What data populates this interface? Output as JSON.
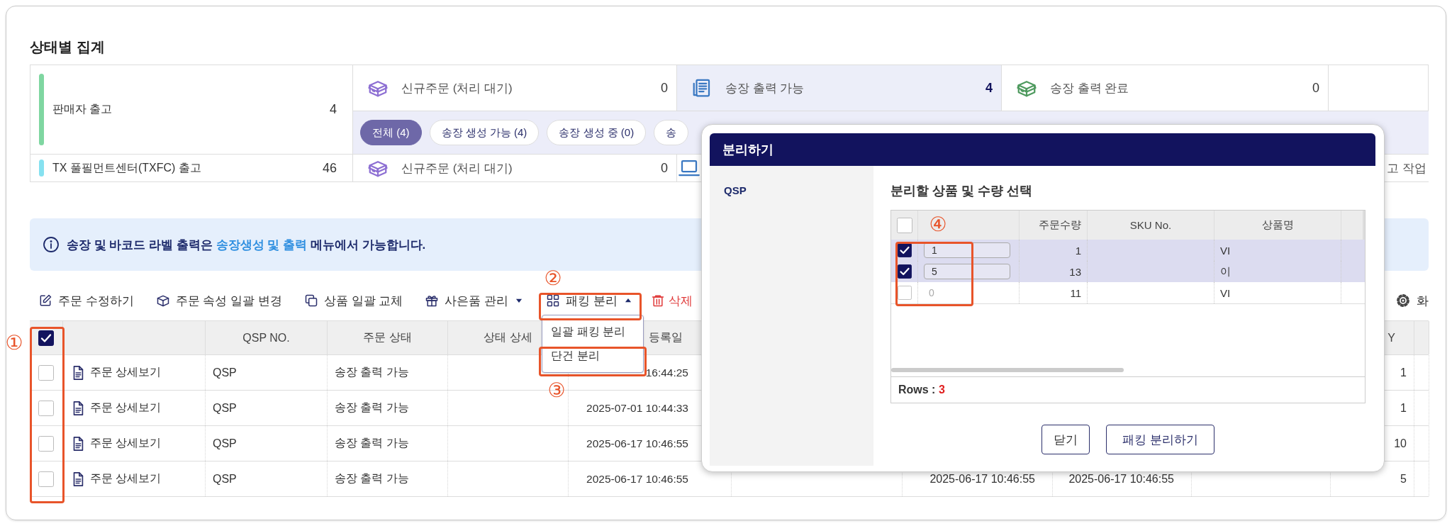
{
  "section_title": "상태별 집계",
  "summary": [
    {
      "name": "판매자 출고",
      "count": "4",
      "color": "#7fd6a1",
      "cells": [
        {
          "kind": "stat",
          "label": "신규주문 (처리 대기)",
          "count": "0",
          "selected": false
        },
        {
          "kind": "stat",
          "label": "송장 출력 가능",
          "count": "4",
          "selected": true
        },
        {
          "kind": "stat",
          "label": "송장 출력 완료",
          "count": "0",
          "selected": false
        }
      ],
      "chips": [
        {
          "label": "전체 (4)",
          "selected": true
        },
        {
          "label": "송장 생성 가능 (4)",
          "selected": false
        },
        {
          "label": "송장 생성 중 (0)",
          "selected": false
        },
        {
          "label": "송",
          "selected": false
        }
      ]
    },
    {
      "name": "TX 풀필먼트센터(TXFC) 출고",
      "count": "46",
      "color": "#86e1f0",
      "cells": [
        {
          "kind": "stat",
          "label": "신규주문 (처리 대기)",
          "count": "0",
          "selected": false
        },
        {
          "kind": "icon"
        },
        {
          "kind": "blank"
        },
        {
          "kind": "text",
          "label": "고 작업"
        }
      ]
    }
  ],
  "notice": {
    "text": "송장 및 바코드 라벨 출력은 ",
    "link": "송장생성 및 출력",
    "text_after": " 메뉴에서 가능합니다."
  },
  "toolbar": [
    {
      "label": "주문 수정하기"
    },
    {
      "label": "주문 속성 일괄 변경"
    },
    {
      "label": "상품 일괄 교체"
    },
    {
      "label": "사은품 관리",
      "expanded": false
    },
    {
      "label": "패킹 분리",
      "expanded": true,
      "menu": [
        {
          "label": "일괄 패킹 분리"
        },
        {
          "label": "단건 분리"
        }
      ]
    },
    {
      "label": "삭제",
      "kind": "danger"
    }
  ],
  "settings": {
    "label": "화"
  },
  "orders": {
    "all_checked": true,
    "headers": {
      "qsp_no": "QSP NO.",
      "status": "주문 상태",
      "status_detail": "상태 상세",
      "registered": "등록일",
      "qty": "Y"
    },
    "rows": [
      {
        "checked": false,
        "detail": "주문 상세보기",
        "qsp_no": "QSP",
        "status": "송장 출력 가능",
        "registered": "16:44:25",
        "qty": "1"
      },
      {
        "checked": false,
        "detail": "주문 상세보기",
        "qsp_no": "QSP",
        "status": "송장 출력 가능",
        "registered": "2025-07-01 10:44:33",
        "qty": "1"
      },
      {
        "checked": false,
        "detail": "주문 상세보기",
        "qsp_no": "QSP",
        "status": "송장 출력 가능",
        "registered": "2025-06-17 10:46:55",
        "qty": "10"
      },
      {
        "checked": false,
        "detail": "주문 상세보기",
        "qsp_no": "QSP",
        "status": "송장 출력 가능",
        "registered": "2025-06-17 10:46:55",
        "column_8": "2025-06-17 10:46:55",
        "column_9": "2025-06-17 10:46:55",
        "qty": "5"
      }
    ]
  },
  "split_dialog": {
    "title": "분리하기",
    "sidebar_item": "QSP",
    "heading": "분리할 상품 및 수량 선택",
    "all_checked": false,
    "headers": {
      "order_qty": "주문수량",
      "sku": "SKU No.",
      "name": "상품명"
    },
    "rows": [
      {
        "checked": true,
        "split_qty": "1",
        "order_qty": "1",
        "name": "VI"
      },
      {
        "checked": true,
        "split_qty": "5",
        "order_qty": "13",
        "name": "이"
      },
      {
        "checked": false,
        "split_qty": "0",
        "order_qty": "11",
        "name": "VI"
      }
    ],
    "rows_label": "Rows : ",
    "row_count": "3",
    "buttons": [
      {
        "label": "닫기",
        "kind": "plain"
      },
      {
        "label": "패킹 분리하기",
        "kind": "primary"
      }
    ]
  },
  "annotations": [
    {
      "label": "①"
    },
    {
      "label": "②"
    },
    {
      "label": "③"
    },
    {
      "label": "④"
    }
  ]
}
